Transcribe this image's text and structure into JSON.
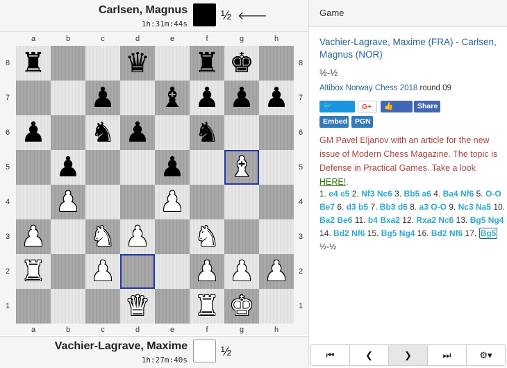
{
  "top_player": {
    "name": "Carlsen, Magnus",
    "clock": "1h:31m:44s",
    "score": "½",
    "arrow": "🡐",
    "color": "#000000"
  },
  "bottom_player": {
    "name": "Vachier-Lagrave, Maxime",
    "clock": "1h:27m:40s",
    "score": "½",
    "color": "#ffffff"
  },
  "board": {
    "files": [
      "a",
      "b",
      "c",
      "d",
      "e",
      "f",
      "g",
      "h"
    ],
    "ranks": [
      "8",
      "7",
      "6",
      "5",
      "4",
      "3",
      "2",
      "1"
    ],
    "highlight_squares": [
      "g5",
      "d2"
    ],
    "pieces": [
      {
        "sq": "a8",
        "glyph": "♜",
        "color": "black",
        "name": "black-rook"
      },
      {
        "sq": "d8",
        "glyph": "♛",
        "color": "black",
        "name": "black-queen"
      },
      {
        "sq": "f8",
        "glyph": "♜",
        "color": "black",
        "name": "black-rook"
      },
      {
        "sq": "g8",
        "glyph": "♚",
        "color": "black",
        "name": "black-king"
      },
      {
        "sq": "c7",
        "glyph": "♟",
        "color": "black",
        "name": "black-pawn"
      },
      {
        "sq": "e7",
        "glyph": "♝",
        "color": "black",
        "name": "black-bishop"
      },
      {
        "sq": "f7",
        "glyph": "♟",
        "color": "black",
        "name": "black-pawn"
      },
      {
        "sq": "g7",
        "glyph": "♟",
        "color": "black",
        "name": "black-pawn"
      },
      {
        "sq": "h7",
        "glyph": "♟",
        "color": "black",
        "name": "black-pawn"
      },
      {
        "sq": "a6",
        "glyph": "♟",
        "color": "black",
        "name": "black-pawn"
      },
      {
        "sq": "c6",
        "glyph": "♞",
        "color": "black",
        "name": "black-knight"
      },
      {
        "sq": "d6",
        "glyph": "♟",
        "color": "black",
        "name": "black-pawn"
      },
      {
        "sq": "f6",
        "glyph": "♞",
        "color": "black",
        "name": "black-knight"
      },
      {
        "sq": "b5",
        "glyph": "♟",
        "color": "black",
        "name": "black-pawn"
      },
      {
        "sq": "e5",
        "glyph": "♟",
        "color": "black",
        "name": "black-pawn"
      },
      {
        "sq": "g5",
        "glyph": "♝",
        "color": "white",
        "name": "white-bishop"
      },
      {
        "sq": "b4",
        "glyph": "♟",
        "color": "white",
        "name": "white-pawn"
      },
      {
        "sq": "e4",
        "glyph": "♟",
        "color": "white",
        "name": "white-pawn"
      },
      {
        "sq": "a3",
        "glyph": "♟",
        "color": "white",
        "name": "white-pawn"
      },
      {
        "sq": "c3",
        "glyph": "♞",
        "color": "white",
        "name": "white-knight"
      },
      {
        "sq": "d3",
        "glyph": "♟",
        "color": "white",
        "name": "white-pawn"
      },
      {
        "sq": "f3",
        "glyph": "♞",
        "color": "white",
        "name": "white-knight"
      },
      {
        "sq": "a2",
        "glyph": "♜",
        "color": "white",
        "name": "white-rook"
      },
      {
        "sq": "c2",
        "glyph": "♟",
        "color": "white",
        "name": "white-pawn"
      },
      {
        "sq": "f2",
        "glyph": "♟",
        "color": "white",
        "name": "white-pawn"
      },
      {
        "sq": "g2",
        "glyph": "♟",
        "color": "white",
        "name": "white-pawn"
      },
      {
        "sq": "h2",
        "glyph": "♟",
        "color": "white",
        "name": "white-pawn"
      },
      {
        "sq": "d1",
        "glyph": "♛",
        "color": "white",
        "name": "white-queen"
      },
      {
        "sq": "f1",
        "glyph": "♜",
        "color": "white",
        "name": "white-rook"
      },
      {
        "sq": "g1",
        "glyph": "♚",
        "color": "white",
        "name": "white-king"
      }
    ]
  },
  "panel": {
    "header": "Game",
    "game_title": "Vachier-Lagrave, Maxime (FRA) - Carlsen, Magnus (NOR)",
    "result": "½-½",
    "event": "Altibox Norway Chess 2018",
    "round": " round 09",
    "social": [
      {
        "label": "🐦 Tweet",
        "color": "#1b95e0"
      },
      {
        "label": "G+",
        "color": "#ffffff"
      },
      {
        "label": "👍 Like",
        "color": "#4267b2"
      },
      {
        "label": "Share",
        "color": "#4267b2"
      }
    ],
    "embed_label": "Embed",
    "pgn_label": "PGN",
    "embed_color": "#337ab7",
    "promo": "GM Pavel Eljanov with an article for the new issue of Modern Chess Magazine. The topic is Defense in Practical Games. Take a look ",
    "promo_link": "HERE!",
    "promo_end": ".",
    "moves": [
      {
        "n": "1.",
        "w": "e4",
        "b": "e5"
      },
      {
        "n": "2.",
        "w": "Nf3",
        "b": "Nc6"
      },
      {
        "n": "3.",
        "w": "Bb5",
        "b": "a6"
      },
      {
        "n": "4.",
        "w": "Ba4",
        "b": "Nf6"
      },
      {
        "n": "5.",
        "w": "O-O",
        "b": "Be7"
      },
      {
        "n": "6.",
        "w": "d3",
        "b": "b5"
      },
      {
        "n": "7.",
        "w": "Bb3",
        "b": "d6"
      },
      {
        "n": "8.",
        "w": "a3",
        "b": "O-O"
      },
      {
        "n": "9.",
        "w": "Nc3",
        "b": "Na5"
      },
      {
        "n": "10.",
        "w": "Ba2",
        "b": "Be6"
      },
      {
        "n": "11.",
        "w": "b4",
        "b": "Bxa2"
      },
      {
        "n": "12.",
        "w": "Rxa2",
        "b": "Nc6"
      },
      {
        "n": "13.",
        "w": "Bg5",
        "b": "Ng4"
      },
      {
        "n": "14.",
        "w": "Bd2",
        "b": "Nf6"
      },
      {
        "n": "15.",
        "w": "Bg5",
        "b": "Ng4"
      },
      {
        "n": "16.",
        "w": "Bd2",
        "b": "Nf6"
      },
      {
        "n": "17.",
        "w": "Bg5",
        "b": ""
      }
    ],
    "current_move": "17w",
    "final_result": "½-½",
    "nav": [
      "⏮",
      "❮",
      "❯",
      "⏭",
      "⚙▾"
    ]
  }
}
